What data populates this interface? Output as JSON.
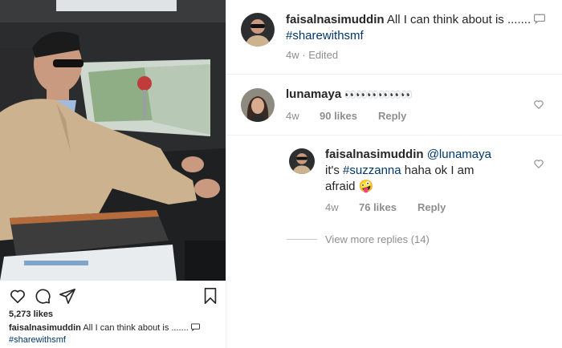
{
  "post": {
    "likes_text": "5,273 likes",
    "caption_user": "faisalnasimuddin",
    "caption_text": "All I can think about is .......",
    "caption_hashtag": "#sharewithsmf",
    "icons": [
      "heart-icon",
      "comment-icon",
      "share-icon",
      "bookmark-icon",
      "speech-bubble-icon"
    ]
  },
  "header_comment": {
    "user": "faisalnasimuddin",
    "text": "All I can think about is .......",
    "hashtag": "#sharewithsmf",
    "time": "4w",
    "edited": "Edited"
  },
  "comments": [
    {
      "user": "lunamaya",
      "text": "👀👀👀👀👀👀",
      "time": "4w",
      "likes": "90 likes",
      "reply": "Reply"
    }
  ],
  "reply": {
    "user": "faisalnasimuddin",
    "mention": "@lunamaya",
    "text_before": "it's",
    "hashtag": "#suzzanna",
    "text_after": "haha ok I am",
    "text_line3": "afraid",
    "emoji": "🤪",
    "time": "4w",
    "likes": "76 likes",
    "reply_label": "Reply"
  },
  "view_more_replies": "View more replies (14)",
  "colors": {
    "text": "#262626",
    "muted": "#8e8e8e",
    "link": "#00376b",
    "border": "#efefef"
  }
}
